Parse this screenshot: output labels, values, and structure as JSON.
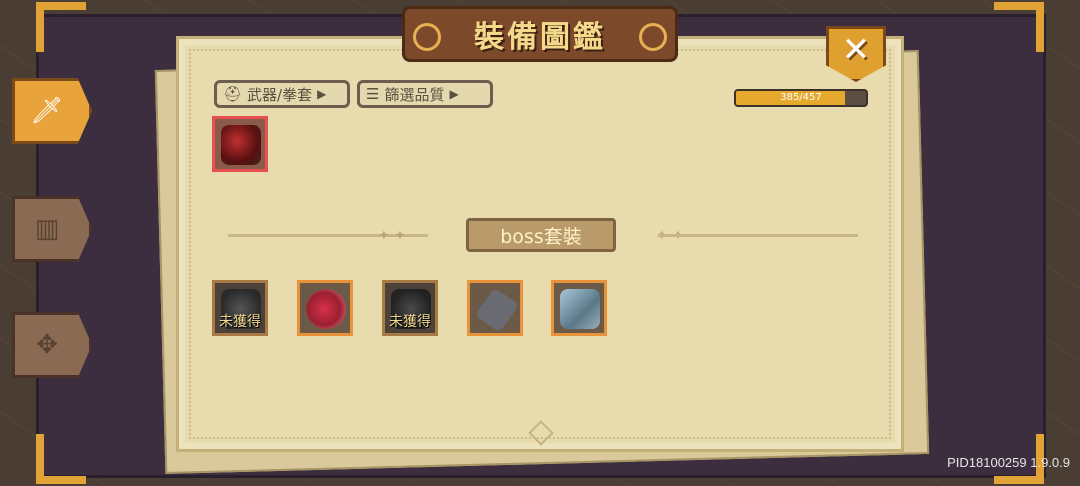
{
  "window": {
    "title": "裝備圖鑑",
    "close_icon": "close-icon"
  },
  "side_tabs": [
    {
      "icon": "sword-icon",
      "active": true
    },
    {
      "icon": "armor-icon",
      "active": false
    },
    {
      "icon": "grid-icon",
      "active": false
    }
  ],
  "filters": {
    "category_label": "武器/拳套",
    "category_icon": "helmet-icon",
    "quality_label": "篩選品質",
    "quality_icon": "list-icon"
  },
  "progress": {
    "text": "385/457",
    "fraction": 0.842
  },
  "section": {
    "title": "boss套裝"
  },
  "items_top": [
    {
      "name": "crimson-gauntlet",
      "state": "obtained"
    }
  ],
  "items_boss": [
    {
      "name": "dark-gauntlet",
      "label": "未獲得",
      "obtained": false
    },
    {
      "name": "flesh-gauntlet",
      "label": "",
      "obtained": true
    },
    {
      "name": "shadow-gauntlet",
      "label": "未獲得",
      "obtained": false
    },
    {
      "name": "iron-gauntlet",
      "label": "",
      "obtained": true
    },
    {
      "name": "ice-gauntlet",
      "label": "",
      "obtained": true
    }
  ],
  "version": "PID18100259 1.9.0.9",
  "colors": {
    "accent": "#e1a236",
    "frame": "#3d2e3f",
    "parchment": "#e8dcae"
  }
}
